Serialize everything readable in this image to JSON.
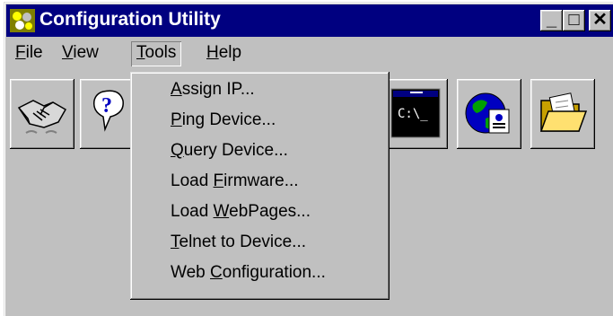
{
  "window": {
    "title": "Configuration Utility"
  },
  "title_buttons": {
    "minimize": "_",
    "maximize": "□",
    "close": "✕"
  },
  "menubar": [
    {
      "name": "File",
      "accel": "F",
      "rest": "ile"
    },
    {
      "name": "View",
      "accel": "V",
      "rest": "iew"
    },
    {
      "name": "Tools",
      "accel": "T",
      "rest": "ools"
    },
    {
      "name": "Help",
      "accel": "H",
      "rest": "elp"
    }
  ],
  "toolbar": {
    "icons": [
      "handshake-icon",
      "help-question-icon",
      "console-icon",
      "web-page-globe-icon",
      "open-folder-icon"
    ],
    "console_text": "C:\\_"
  },
  "tools_menu": {
    "items": [
      {
        "pre": "",
        "accel": "A",
        "post": "ssign IP..."
      },
      {
        "pre": "",
        "accel": "P",
        "post": "ing Device..."
      },
      {
        "pre": "",
        "accel": "Q",
        "post": "uery Device..."
      },
      {
        "pre": "Load ",
        "accel": "F",
        "post": "irmware..."
      },
      {
        "pre": "Load ",
        "accel": "W",
        "post": "ebPages..."
      },
      {
        "pre": "",
        "accel": "T",
        "post": "elnet to Device..."
      },
      {
        "pre": "Web ",
        "accel": "C",
        "post": "onfiguration..."
      }
    ]
  },
  "colors": {
    "titlebar": "#000080",
    "face": "#c0c0c0"
  }
}
